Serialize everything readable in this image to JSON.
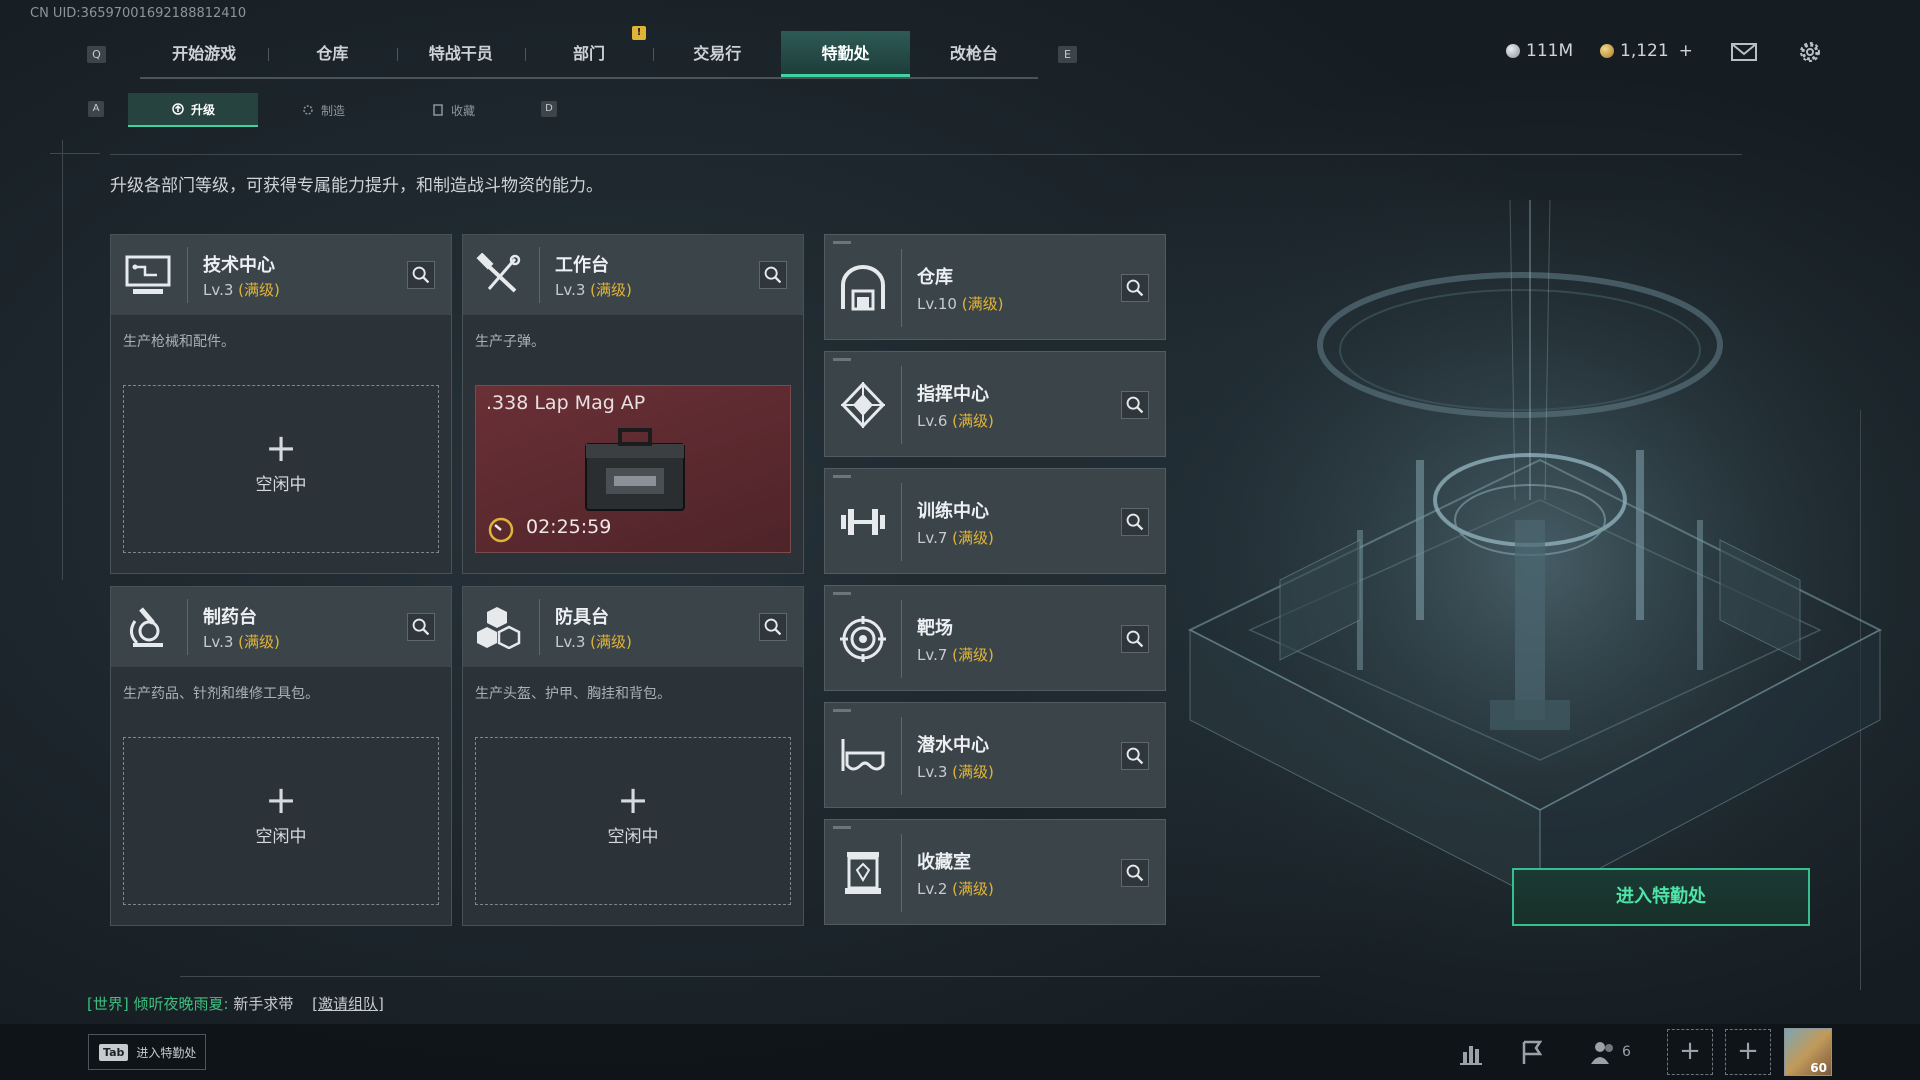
{
  "uid": "CN UID:36597001692188812410",
  "key_hints": {
    "prev_tab": "Q",
    "next_tab": "E",
    "prev_sub": "A",
    "next_sub": "D"
  },
  "notice_badge": "!",
  "nav": {
    "tabs": [
      "开始游戏",
      "仓库",
      "特战干员",
      "部门",
      "交易行",
      "特勤处",
      "改枪台"
    ],
    "active": "特勤处"
  },
  "currency": {
    "silver": "111M",
    "gold": "1,121",
    "gold_add": "+"
  },
  "subnav": {
    "tabs": [
      "升级",
      "制造",
      "收藏"
    ],
    "active": "升级"
  },
  "description": "升级各部门等级，可获得专属能力提升，和制造战斗物资的能力。",
  "large_cards": [
    {
      "title": "技术中心",
      "level": "Lv.3",
      "maxed": "(满级)",
      "desc": "生产枪械和配件。",
      "slot": {
        "plus": "+",
        "label": "空闲中"
      }
    },
    {
      "title": "工作台",
      "level": "Lv.3",
      "maxed": "(满级)",
      "desc": "生产子弹。",
      "crafting": {
        "item": ".338 Lap Mag AP",
        "timer": "02:25:59"
      }
    },
    {
      "title": "制药台",
      "level": "Lv.3",
      "maxed": "(满级)",
      "desc": "生产药品、针剂和维修工具包。",
      "slot": {
        "plus": "+",
        "label": "空闲中"
      }
    },
    {
      "title": "防具台",
      "level": "Lv.3",
      "maxed": "(满级)",
      "desc": "生产头盔、护甲、胸挂和背包。",
      "slot": {
        "plus": "+",
        "label": "空闲中"
      }
    }
  ],
  "small_cards": [
    {
      "title": "仓库",
      "level": "Lv.10",
      "maxed": "(满级)"
    },
    {
      "title": "指挥中心",
      "level": "Lv.6",
      "maxed": "(满级)"
    },
    {
      "title": "训练中心",
      "level": "Lv.7",
      "maxed": "(满级)"
    },
    {
      "title": "靶场",
      "level": "Lv.7",
      "maxed": "(满级)"
    },
    {
      "title": "潜水中心",
      "level": "Lv.3",
      "maxed": "(满级)"
    },
    {
      "title": "收藏室",
      "level": "Lv.2",
      "maxed": "(满级)"
    }
  ],
  "enter_button": "进入特勤处",
  "chat": {
    "channel": "[世界]",
    "sender": "倾听夜晚雨夏:",
    "message": "新手求带",
    "invite": "[邀请组队]"
  },
  "bottom": {
    "tab_key": "Tab",
    "tab_label": "进入特勤处",
    "friends_count": "6",
    "add": "+",
    "avatar_level": "60"
  },
  "colors": {
    "accent": "#3fd3a0",
    "maxed": "#e0b437",
    "crafting_bg": "#5a282d"
  }
}
